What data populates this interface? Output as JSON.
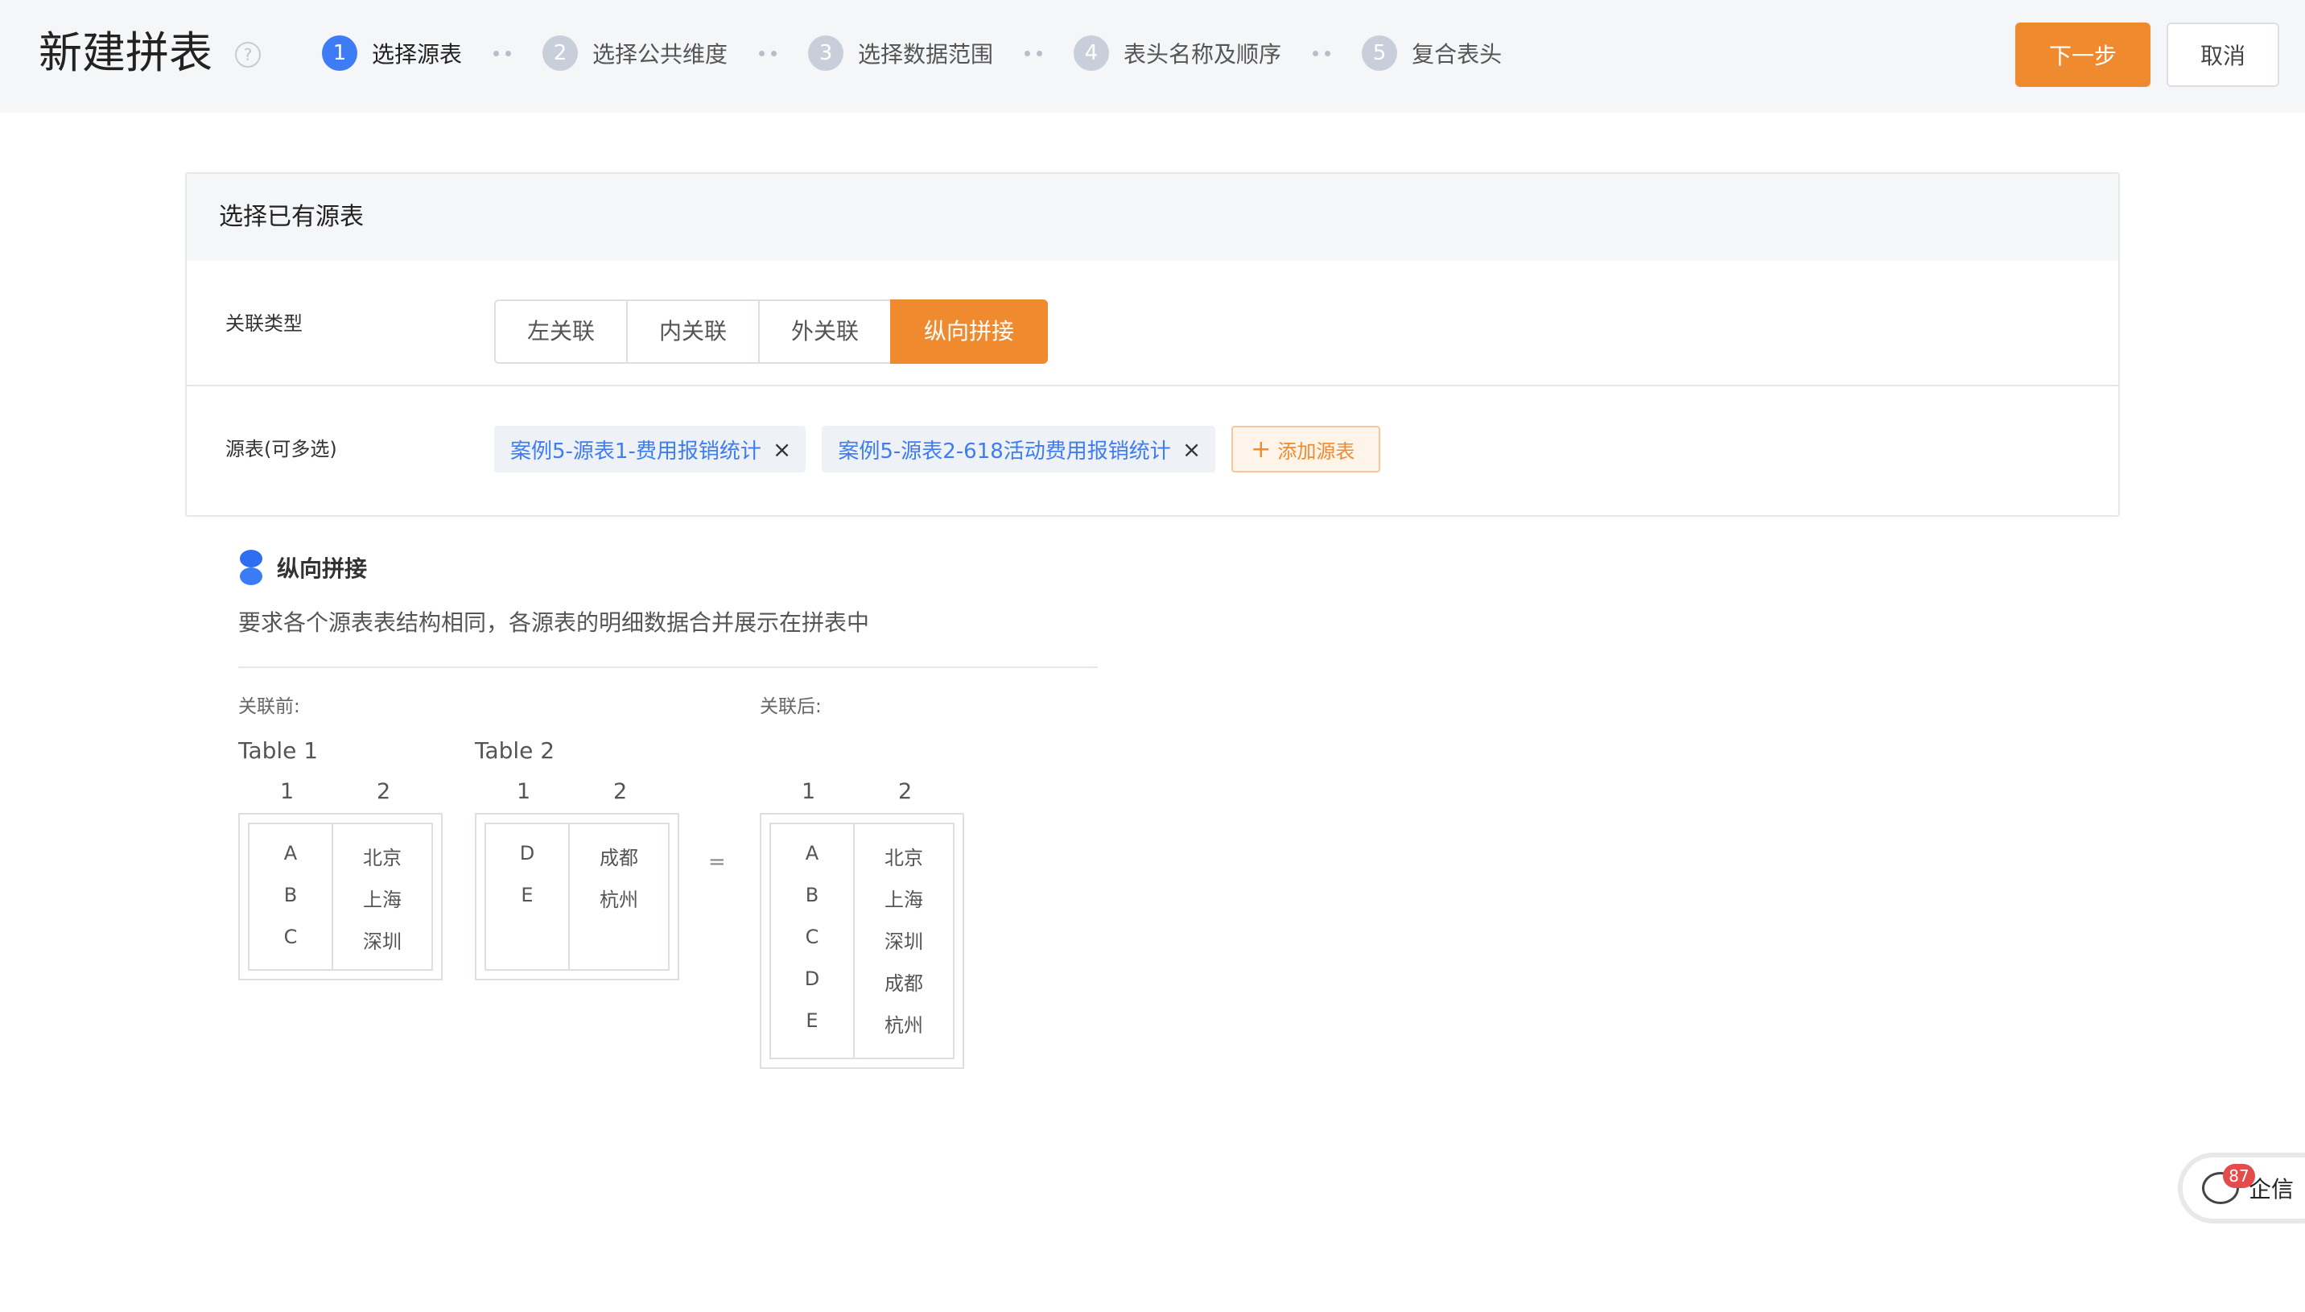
{
  "header": {
    "title": "新建拼表",
    "help_icon": "question-circle-icon",
    "steps": [
      {
        "num": "1",
        "label": "选择源表",
        "active": true
      },
      {
        "num": "2",
        "label": "选择公共维度",
        "active": false
      },
      {
        "num": "3",
        "label": "选择数据范围",
        "active": false
      },
      {
        "num": "4",
        "label": "表头名称及顺序",
        "active": false
      },
      {
        "num": "5",
        "label": "复合表头",
        "active": false
      }
    ],
    "next_label": "下一步",
    "cancel_label": "取消"
  },
  "card": {
    "title": "选择已有源表",
    "join_type": {
      "label": "关联类型",
      "options": [
        "左关联",
        "内关联",
        "外关联",
        "纵向拼接"
      ],
      "selected": "纵向拼接"
    },
    "sources": {
      "label": "源表(可多选)",
      "tags": [
        "案例5-源表1-费用报销统计",
        "案例5-源表2-618活动费用报销统计"
      ],
      "add_label": "添加源表"
    }
  },
  "description": {
    "title": "纵向拼接",
    "body": "要求各个源表表结构相同，各源表的明细数据合并展示在拼表中",
    "before_label": "关联前:",
    "after_label": "关联后:",
    "table1": {
      "title": "Table 1",
      "cols": [
        "1",
        "2"
      ],
      "rows": [
        [
          "A",
          "北京"
        ],
        [
          "B",
          "上海"
        ],
        [
          "C",
          "深圳"
        ]
      ]
    },
    "table2": {
      "title": "Table 2",
      "cols": [
        "1",
        "2"
      ],
      "rows": [
        [
          "D",
          "成都"
        ],
        [
          "E",
          "杭州"
        ]
      ]
    },
    "equals": "=",
    "result": {
      "cols": [
        "1",
        "2"
      ],
      "rows": [
        [
          "A",
          "北京"
        ],
        [
          "B",
          "上海"
        ],
        [
          "C",
          "深圳"
        ],
        [
          "D",
          "成都"
        ],
        [
          "E",
          "杭州"
        ]
      ]
    }
  },
  "chat": {
    "badge": "87",
    "label": "企信",
    "icon": "chat-bubble-icon"
  },
  "colors": {
    "accent": "#f08a2e",
    "primary": "#3d7cf5"
  }
}
